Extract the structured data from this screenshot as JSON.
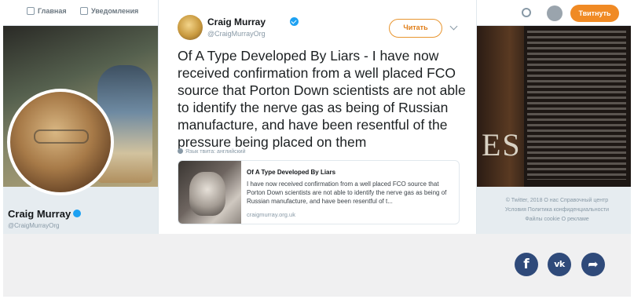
{
  "topnav": {
    "home_label": "Главная",
    "notifications_label": "Уведомления",
    "tweet_button": "Твитнуть"
  },
  "profile": {
    "name": "Craig Murray",
    "handle": "@CraigMurrayOrg"
  },
  "banner": {
    "book_letters": "ES"
  },
  "footer": {
    "line1": "© Twitter, 2018   О нас   Справочный центр",
    "line2": "Условия   Политика конфиденциальности",
    "line3": "Файлы cookie   О рекламе"
  },
  "tweet": {
    "author_name": "Craig Murray",
    "author_handle": "@CraigMurrayOrg",
    "follow_label": "Читать",
    "text": "Of A Type Developed By Liars - I have now received confirmation from a well placed FCO source that Porton Down scientists are not able to identify the nerve gas as being of Russian manufacture, and have been resentful of the pressure being placed on them",
    "translate_note": "Язык твита: английский",
    "card": {
      "title": "Of A Type Developed By Liars",
      "description": "I have now received confirmation from a well placed FCO source that Porton Down scientists are not able to identify the nerve gas as being of Russian manufacture, and have been resentful of t...",
      "domain": "craigmurray.org.uk"
    }
  },
  "share": {
    "facebook_glyph": "f",
    "vk_glyph": "vk",
    "arrow_glyph": "➦"
  },
  "colors": {
    "twitter_blue": "#1da1f2",
    "follow_orange": "#e07d16",
    "share_button": "#2f4a7a"
  }
}
